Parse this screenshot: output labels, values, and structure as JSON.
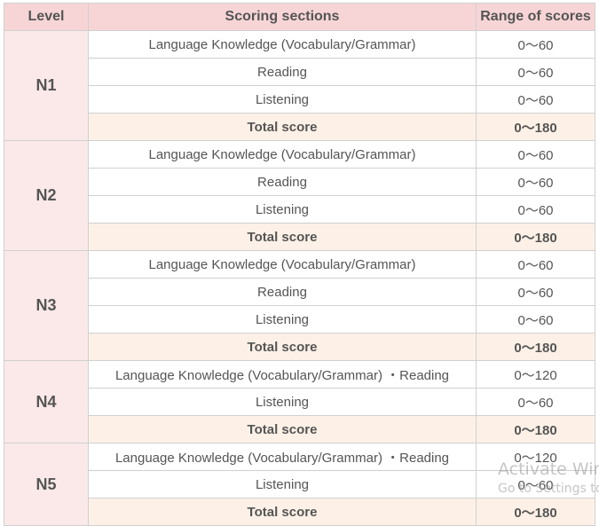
{
  "headers": {
    "level": "Level",
    "sections": "Scoring sections",
    "range": "Range of scores"
  },
  "groups": [
    {
      "level": "N1",
      "rows": [
        {
          "section": "Language Knowledge (Vocabulary/Grammar)",
          "range": "0～60"
        },
        {
          "section": "Reading",
          "range": "0～60"
        },
        {
          "section": "Listening",
          "range": "0～60"
        },
        {
          "section": "Total score",
          "range": "0～180",
          "total": true
        }
      ]
    },
    {
      "level": "N2",
      "rows": [
        {
          "section": "Language Knowledge (Vocabulary/Grammar)",
          "range": "0～60"
        },
        {
          "section": "Reading",
          "range": "0～60"
        },
        {
          "section": "Listening",
          "range": "0～60"
        },
        {
          "section": "Total score",
          "range": "0～180",
          "total": true
        }
      ]
    },
    {
      "level": "N3",
      "rows": [
        {
          "section": "Language Knowledge (Vocabulary/Grammar)",
          "range": "0～60"
        },
        {
          "section": "Reading",
          "range": "0～60"
        },
        {
          "section": "Listening",
          "range": "0～60"
        },
        {
          "section": "Total score",
          "range": "0～180",
          "total": true
        }
      ]
    },
    {
      "level": "N4",
      "rows": [
        {
          "section": "Language Knowledge (Vocabulary/Grammar) ・Reading",
          "range": "0～120"
        },
        {
          "section": "Listening",
          "range": "0～60"
        },
        {
          "section": "Total score",
          "range": "0～180",
          "total": true
        }
      ]
    },
    {
      "level": "N5",
      "rows": [
        {
          "section": "Language Knowledge (Vocabulary/Grammar) ・Reading",
          "range": "0～120"
        },
        {
          "section": "Listening",
          "range": "0～60"
        },
        {
          "section": "Total score",
          "range": "0～180",
          "total": true
        }
      ]
    }
  ],
  "watermark": {
    "line1": "Activate Windows",
    "line2": "Go to Settings to activate Windows."
  }
}
